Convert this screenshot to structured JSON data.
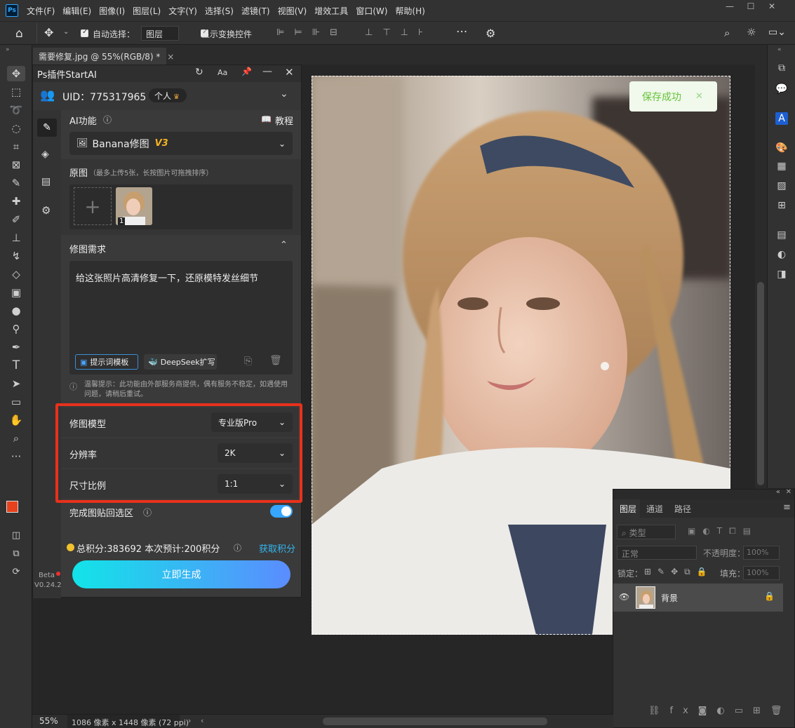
{
  "app": {
    "logo": "Ps"
  },
  "menu": [
    "文件(F)",
    "编辑(E)",
    "图像(I)",
    "图层(L)",
    "文字(Y)",
    "选择(S)",
    "滤镜(T)",
    "视图(V)",
    "增效工具",
    "窗口(W)",
    "帮助(H)"
  ],
  "options": {
    "auto_select_label": "自动选择：",
    "auto_select_value": "图层",
    "show_transform_label": "显示变换控件"
  },
  "document": {
    "tab_title": "需要修复.jpg @ 55%(RGB/8) *"
  },
  "plugin": {
    "title": "Ps插件StartAI",
    "font_btn": "Aa",
    "uid": "UID：775317965",
    "plan": "个人",
    "ai_feature_label": "AI功能",
    "tutorial": "教程",
    "feature_select": "Banana修图",
    "feature_version": "V3",
    "original_label": "原图",
    "original_hint": "（最多上传5张，长按图片可拖拽排序）",
    "thumb_index": "1",
    "requirement_label": "修图需求",
    "prompt_text": "给这张照片高清修复一下，还原模特发丝细节",
    "prompt_template_btn": "提示词模板",
    "deepseek_btn": "DeepSeek扩写",
    "notice": "温馨提示：此功能由外部服务商提供，偶有服务不稳定，如遇使用问题，请稍后重试。",
    "settings": [
      {
        "label": "修图模型",
        "value": "专业版Pro"
      },
      {
        "label": "分辨率",
        "value": "2K"
      },
      {
        "label": "尺寸比例",
        "value": "1:1"
      }
    ],
    "paste_back_label": "完成图贴回选区",
    "paste_back_on": true,
    "points_text": "总积分:383692  本次预计:200积分",
    "get_points": "获取积分",
    "generate_btn": "立即生成",
    "beta": "Beta",
    "version": "V0.24.2"
  },
  "toast": {
    "text": "保存成功"
  },
  "layers": {
    "tabs": [
      "图层",
      "通道",
      "路径"
    ],
    "filter_label": "类型",
    "blend_mode": "正常",
    "opacity_label": "不透明度：",
    "opacity_value": "100%",
    "lock_label": "锁定：",
    "fill_label": "填充：",
    "fill_value": "100%",
    "items": [
      {
        "name": "背景"
      }
    ]
  },
  "status": {
    "zoom": "55%",
    "info": "1086 像素 x 1448 像素 (72 ppi)"
  },
  "colors": {
    "accent_red": "#e8311c",
    "toggle": "#36a6ff",
    "gen_start": "#12e4e8",
    "gen_end": "#5b8cff",
    "fg_color": "#e8411d"
  }
}
